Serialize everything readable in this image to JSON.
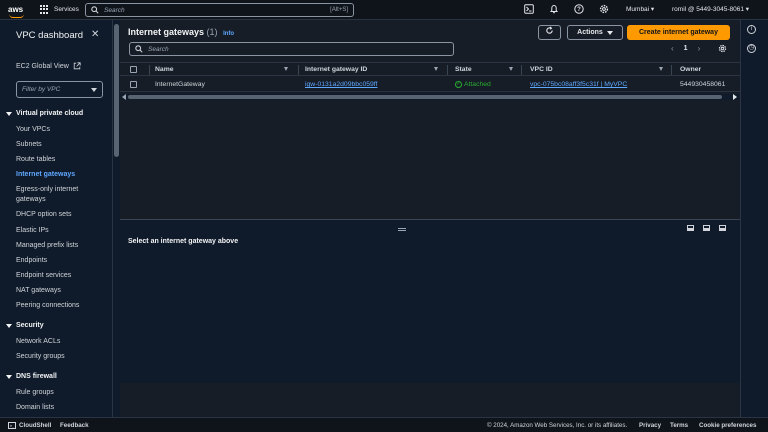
{
  "topnav": {
    "logo": "aws",
    "services": "Services",
    "search_placeholder": "Search",
    "search_shortcut": "[Alt+S]",
    "region": "Mumbai ▾",
    "account": "romil @ 5449-3045-8061 ▾"
  },
  "sidebar": {
    "title": "VPC dashboard",
    "ec2_global_view": "EC2 Global View",
    "filter_placeholder": "Filter by VPC",
    "section_vpc": "Virtual private cloud",
    "vpc_items": [
      "Your VPCs",
      "Subnets",
      "Route tables",
      "Internet gateways",
      "Egress-only internet gateways",
      "DHCP option sets",
      "Elastic IPs",
      "Managed prefix lists",
      "Endpoints",
      "Endpoint services",
      "NAT gateways",
      "Peering connections"
    ],
    "section_security": "Security",
    "security_items": [
      "Network ACLs",
      "Security groups"
    ],
    "section_dns": "DNS firewall",
    "dns_items": [
      "Rule groups",
      "Domain lists"
    ]
  },
  "panel": {
    "title": "Internet gateways",
    "count": "(1)",
    "info": "Info",
    "actions": "Actions",
    "create": "Create internet gateway",
    "search_placeholder": "Search",
    "page": "1"
  },
  "table": {
    "headers": [
      "Name",
      "Internet gateway ID",
      "State",
      "VPC ID",
      "Owner"
    ],
    "row": {
      "name": "InternetGateway",
      "gateway_id": "igw-0131a2d09bbc059ff",
      "state": "Attached",
      "vpc_id": "vpc-075bc08aff3f5c31f | MyVPC",
      "owner": "544930458061"
    }
  },
  "split": {
    "message": "Select an internet gateway above"
  },
  "footer": {
    "cloudshell": "CloudShell",
    "feedback": "Feedback",
    "copyright": "© 2024, Amazon Web Services, Inc. or its affiliates.",
    "privacy": "Privacy",
    "terms": "Terms",
    "cookie": "Cookie preferences"
  },
  "colors": {
    "accent_orange": "#ff9900",
    "link_blue": "#5fa8ff",
    "success_green": "#29ad32",
    "nav_bg": "#0f141a",
    "panel_bg": "#161d26"
  }
}
